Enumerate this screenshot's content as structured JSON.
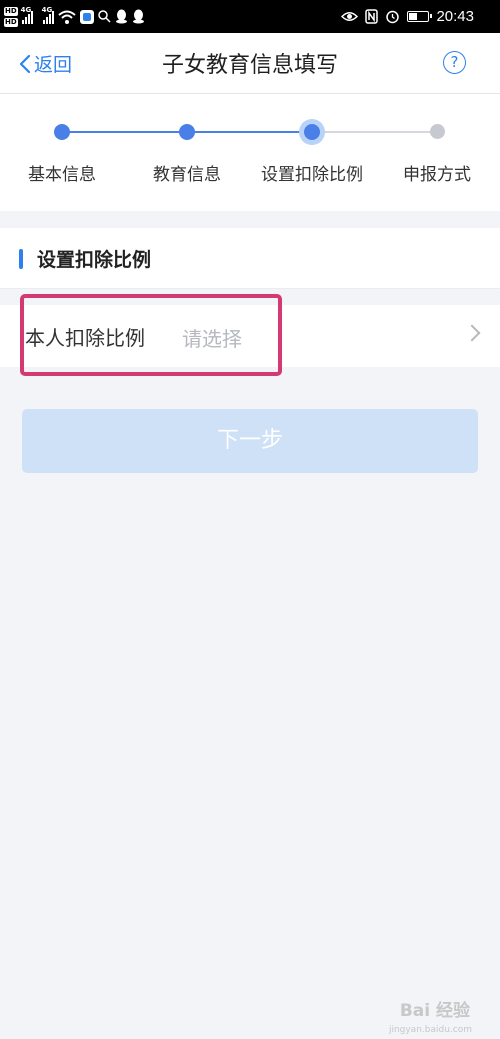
{
  "status_bar": {
    "hd_badges": [
      "HD",
      "HD"
    ],
    "network_labels": [
      "4G",
      "4G"
    ],
    "time": "20:43",
    "icons": [
      "wifi-icon",
      "app-icon",
      "search-icon",
      "qq-icon",
      "qq-icon",
      "eye-icon",
      "nfc-icon",
      "alarm-icon",
      "battery-icon"
    ]
  },
  "nav": {
    "back_label": "返回",
    "title": "子女教育信息填写",
    "help_label": "?"
  },
  "steps": {
    "items": [
      {
        "label": "基本信息",
        "state": "done"
      },
      {
        "label": "教育信息",
        "state": "done"
      },
      {
        "label": "设置扣除比例",
        "state": "current"
      },
      {
        "label": "申报方式",
        "state": "pending"
      }
    ],
    "colors": {
      "done": "#4a7fe8",
      "pending": "#c7c9d0"
    }
  },
  "section": {
    "title": "设置扣除比例"
  },
  "form": {
    "ratio_label": "本人扣除比例",
    "ratio_placeholder": "请选择"
  },
  "next_button": {
    "label": "下一步"
  },
  "watermark": {
    "text": "Bai 经验",
    "sub": "jingyan.baidu.com"
  },
  "colors": {
    "accent": "#2f80ed",
    "highlight": "#d43a72",
    "button_disabled": "#cfe1f7"
  }
}
